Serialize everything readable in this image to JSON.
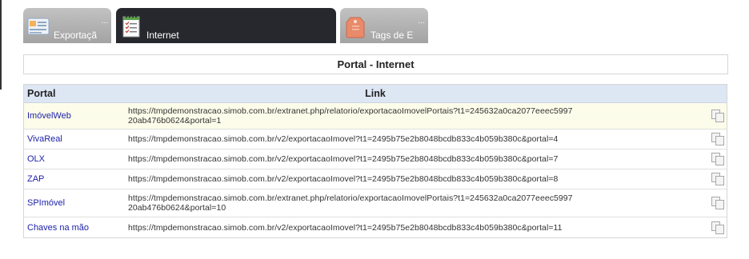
{
  "tabs": [
    {
      "label": "Exportaçã",
      "icon": "document-list-icon",
      "state": "inactive"
    },
    {
      "label": "Internet",
      "icon": "notepad-checklist-icon",
      "state": "active"
    },
    {
      "label": "Tags de E",
      "icon": "price-tag-icon",
      "state": "inactive"
    }
  ],
  "tab_more": "...",
  "panel_title": "Portal - Internet",
  "table": {
    "columns": [
      "Portal",
      "Link"
    ],
    "rows": [
      {
        "portal": "ImóvelWeb",
        "link": "https://tmpdemonstracao.simob.com.br/extranet.php/relatorio/exportacaoImovelPortais?t1=245632a0ca2077eeec599720ab476b0624&portal=1"
      },
      {
        "portal": "VivaReal",
        "link": "https://tmpdemonstracao.simob.com.br/v2/exportacaoImovel?t1=2495b75e2b8048bcdb833c4b059b380c&portal=4"
      },
      {
        "portal": "OLX",
        "link": "https://tmpdemonstracao.simob.com.br/v2/exportacaoImovel?t1=2495b75e2b8048bcdb833c4b059b380c&portal=7"
      },
      {
        "portal": "ZAP",
        "link": "https://tmpdemonstracao.simob.com.br/v2/exportacaoImovel?t1=2495b75e2b8048bcdb833c4b059b380c&portal=8"
      },
      {
        "portal": "SPImóvel",
        "link": "https://tmpdemonstracao.simob.com.br/extranet.php/relatorio/exportacaoImovelPortais?t1=245632a0ca2077eeec599720ab476b0624&portal=10"
      },
      {
        "portal": "Chaves na mão",
        "link": "https://tmpdemonstracao.simob.com.br/v2/exportacaoImovel?t1=2495b75e2b8048bcdb833c4b059b380c&portal=11"
      }
    ],
    "copy_icon": "copy-icon"
  },
  "colors": {
    "active_tab": "#26282d",
    "inactive_tab": "#b3b3b3",
    "header_bg": "#dde6f3",
    "highlight_row": "#fcfcea",
    "portal_link": "#1b1fa8"
  }
}
